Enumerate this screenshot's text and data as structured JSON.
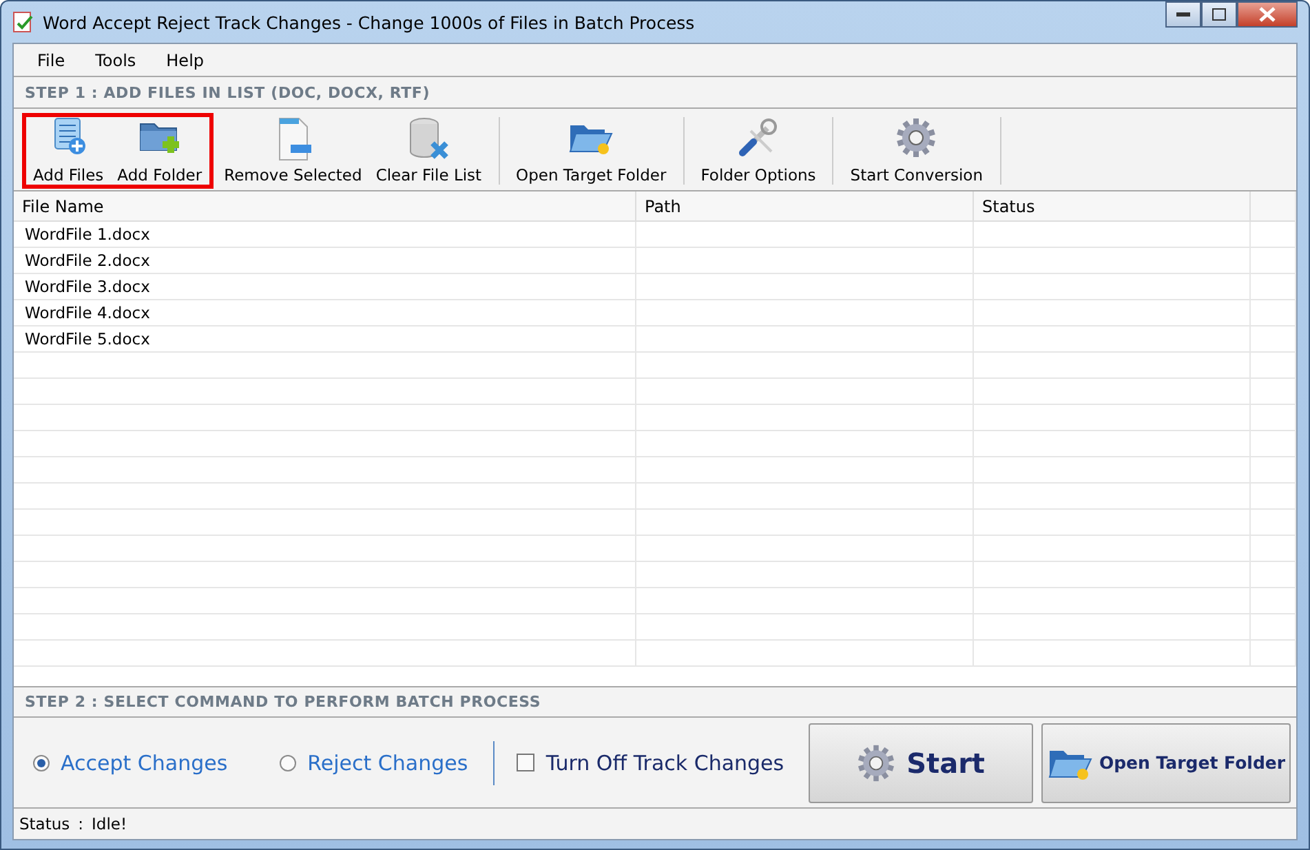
{
  "window": {
    "title": "Word Accept Reject Track Changes - Change 1000s of Files in Batch Process"
  },
  "menu": [
    "File",
    "Tools",
    "Help"
  ],
  "step1": {
    "title": "STEP 1 : ADD FILES IN LIST (DOC, DOCX, RTF)"
  },
  "toolbar": [
    {
      "highlighted": true,
      "buttons": [
        {
          "kind": "add-files",
          "label": "Add Files"
        },
        {
          "kind": "add-folder",
          "label": "Add Folder"
        }
      ]
    },
    {
      "highlighted": false,
      "buttons": [
        {
          "kind": "remove",
          "label": "Remove Selected"
        },
        {
          "kind": "clear",
          "label": "Clear File List"
        }
      ]
    },
    {
      "highlighted": false,
      "buttons": [
        {
          "kind": "open-folder",
          "label": "Open Target Folder"
        }
      ]
    },
    {
      "highlighted": false,
      "buttons": [
        {
          "kind": "options",
          "label": "Folder Options"
        }
      ]
    },
    {
      "highlighted": false,
      "buttons": [
        {
          "kind": "gear",
          "label": "Start Conversion"
        }
      ]
    }
  ],
  "table": {
    "columns": [
      "File Name",
      "Path",
      "Status"
    ],
    "rows": [
      [
        "WordFile 1.docx"
      ],
      [
        "WordFile 2.docx"
      ],
      [
        "WordFile 3.docx"
      ],
      [
        "WordFile 4.docx"
      ],
      [
        "WordFile 5.docx"
      ]
    ]
  },
  "step2": {
    "title": "STEP 2 : SELECT COMMAND TO PERFORM BATCH PROCESS"
  },
  "options": [
    {
      "label": "Accept Changes",
      "selected": true
    },
    {
      "label": "Reject Changes",
      "selected": false
    }
  ],
  "turn_off": {
    "label": "Turn Off Track Changes",
    "checked": false
  },
  "start_button": "Start",
  "open_button": "Open Target Folder",
  "status_bar": {
    "label": "Status",
    "separator": ":",
    "value": "Idle!"
  }
}
